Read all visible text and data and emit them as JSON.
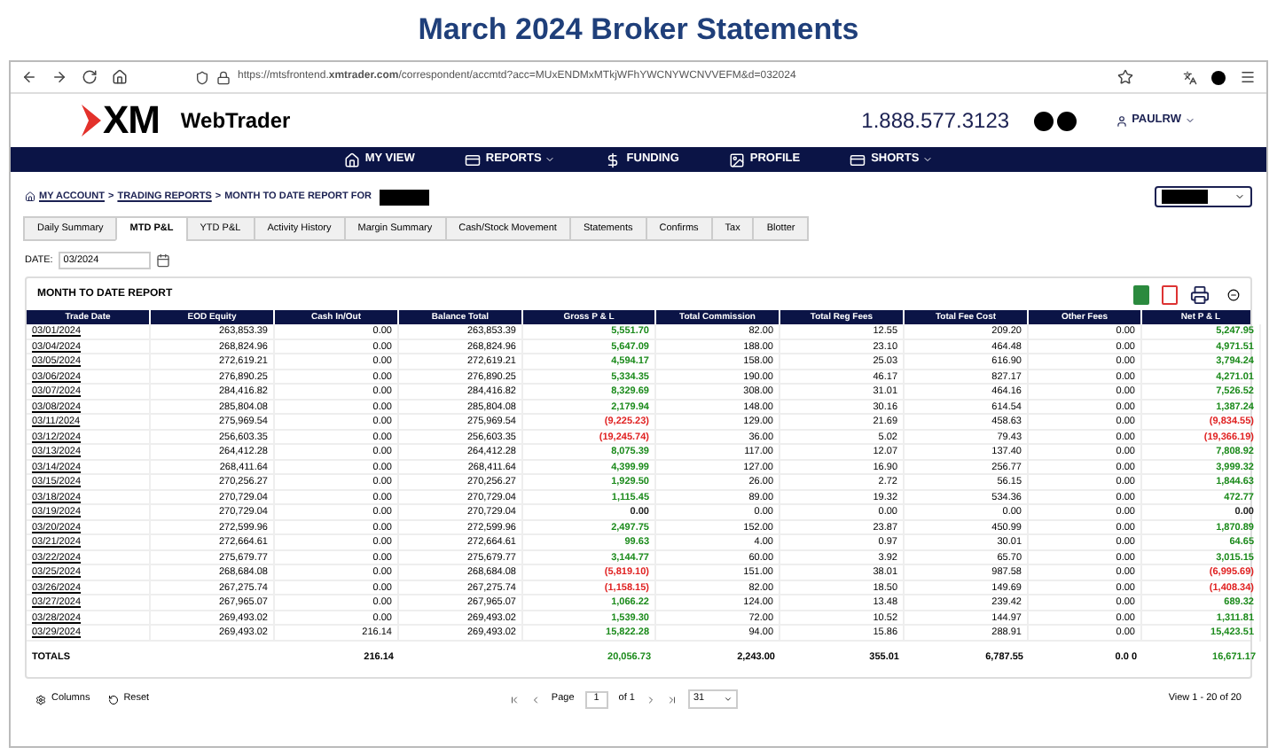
{
  "page_title": "March 2024 Broker Statements",
  "browser": {
    "url": "https://mtsfrontend.**xmtrader.com**/correspondent/accmtd?acc=MUxENDMxMTkjWFhYWCNYWCNVVEFM&d=032024"
  },
  "header": {
    "logo": "XM",
    "app_name": "WebTrader",
    "phone": "1.888.577.3123",
    "user": "PAULRW"
  },
  "nav": [
    {
      "label": "MY VIEW",
      "kind": "home",
      "dropdown": false
    },
    {
      "label": "REPORTS",
      "kind": "card",
      "dropdown": true
    },
    {
      "label": "FUNDING",
      "kind": "dollar",
      "dropdown": false
    },
    {
      "label": "PROFILE",
      "kind": "image",
      "dropdown": false
    },
    {
      "label": "SHORTS",
      "kind": "card",
      "dropdown": true
    }
  ],
  "breadcrumb": [
    {
      "label": "MY ACCOUNT",
      "link": true
    },
    {
      "label": ">",
      "link": false
    },
    {
      "label": "TRADING REPORTS",
      "link": true
    },
    {
      "label": ">",
      "link": false
    },
    {
      "label": "MONTH TO DATE REPORT FOR",
      "link": false
    }
  ],
  "tabs": [
    {
      "label": "Daily Summary",
      "selected": false
    },
    {
      "label": "MTD P&L",
      "selected": true
    },
    {
      "label": "YTD P&L",
      "selected": false
    },
    {
      "label": "Activity History",
      "selected": false
    },
    {
      "label": "Margin Summary",
      "selected": false
    },
    {
      "label": "Cash/Stock Movement",
      "selected": false
    },
    {
      "label": "Statements",
      "selected": false
    },
    {
      "label": "Confirms",
      "selected": false
    },
    {
      "label": "Tax",
      "selected": false
    },
    {
      "label": "Blotter",
      "selected": false
    }
  ],
  "date": {
    "label": "DATE:",
    "value": "03/2024"
  },
  "report": {
    "title": "MONTH TO DATE REPORT",
    "columns": [
      "Trade Date",
      "EOD Equity",
      "Cash In/Out",
      "Balance Total",
      "Gross P & L",
      "Total Commission",
      "Total Reg Fees",
      "Total Fee Cost",
      "Other Fees",
      "Net P & L"
    ],
    "rows": [
      {
        "cells": [
          "03/01/2024",
          "263,853.39",
          "0.00",
          "263,853.39",
          {
            "value": "5,551.70",
            "color": "#1a8a1a"
          },
          "82.00",
          "12.55",
          "209.20",
          "0.00",
          {
            "value": "5,247.95",
            "color": "#1a8a1a"
          }
        ]
      },
      {
        "cells": [
          "03/04/2024",
          "268,824.96",
          "0.00",
          "268,824.96",
          {
            "value": "5,647.09",
            "color": "#1a8a1a"
          },
          "188.00",
          "23.10",
          "464.48",
          "0.00",
          {
            "value": "4,971.51",
            "color": "#1a8a1a"
          }
        ]
      },
      {
        "cells": [
          "03/05/2024",
          "272,619.21",
          "0.00",
          "272,619.21",
          {
            "value": "4,594.17",
            "color": "#1a8a1a"
          },
          "158.00",
          "25.03",
          "616.90",
          "0.00",
          {
            "value": "3,794.24",
            "color": "#1a8a1a"
          }
        ]
      },
      {
        "cells": [
          "03/06/2024",
          "276,890.25",
          "0.00",
          "276,890.25",
          {
            "value": "5,334.35",
            "color": "#1a8a1a"
          },
          "190.00",
          "46.17",
          "827.17",
          "0.00",
          {
            "value": "4,271.01",
            "color": "#1a8a1a"
          }
        ]
      },
      {
        "cells": [
          "03/07/2024",
          "284,416.82",
          "0.00",
          "284,416.82",
          {
            "value": "8,329.69",
            "color": "#1a8a1a"
          },
          "308.00",
          "31.01",
          "464.16",
          "0.00",
          {
            "value": "7,526.52",
            "color": "#1a8a1a"
          }
        ]
      },
      {
        "cells": [
          "03/08/2024",
          "285,804.08",
          "0.00",
          "285,804.08",
          {
            "value": "2,179.94",
            "color": "#1a8a1a"
          },
          "148.00",
          "30.16",
          "614.54",
          "0.00",
          {
            "value": "1,387.24",
            "color": "#1a8a1a"
          }
        ]
      },
      {
        "cells": [
          "03/11/2024",
          "275,969.54",
          "0.00",
          "275,969.54",
          {
            "value": "(9,225.23)",
            "color": "#e02020"
          },
          "129.00",
          "21.69",
          "458.63",
          "0.00",
          {
            "value": "(9,834.55)",
            "color": "#e02020"
          }
        ]
      },
      {
        "cells": [
          "03/12/2024",
          "256,603.35",
          "0.00",
          "256,603.35",
          {
            "value": "(19,245.74)",
            "color": "#e02020"
          },
          "36.00",
          "5.02",
          "79.43",
          "0.00",
          {
            "value": "(19,366.19)",
            "color": "#e02020"
          }
        ]
      },
      {
        "cells": [
          "03/13/2024",
          "264,412.28",
          "0.00",
          "264,412.28",
          {
            "value": "8,075.39",
            "color": "#1a8a1a"
          },
          "117.00",
          "12.07",
          "137.40",
          "0.00",
          {
            "value": "7,808.92",
            "color": "#1a8a1a"
          }
        ]
      },
      {
        "cells": [
          "03/14/2024",
          "268,411.64",
          "0.00",
          "268,411.64",
          {
            "value": "4,399.99",
            "color": "#1a8a1a"
          },
          "127.00",
          "16.90",
          "256.77",
          "0.00",
          {
            "value": "3,999.32",
            "color": "#1a8a1a"
          }
        ]
      },
      {
        "cells": [
          "03/15/2024",
          "270,256.27",
          "0.00",
          "270,256.27",
          {
            "value": "1,929.50",
            "color": "#1a8a1a"
          },
          "26.00",
          "2.72",
          "56.15",
          "0.00",
          {
            "value": "1,844.63",
            "color": "#1a8a1a"
          }
        ]
      },
      {
        "cells": [
          "03/18/2024",
          "270,729.04",
          "0.00",
          "270,729.04",
          {
            "value": "1,115.45",
            "color": "#1a8a1a"
          },
          "89.00",
          "19.32",
          "534.36",
          "0.00",
          {
            "value": "472.77",
            "color": "#1a8a1a"
          }
        ]
      },
      {
        "cells": [
          "03/19/2024",
          "270,729.04",
          "0.00",
          "270,729.04",
          {
            "value": "0.00",
            "color": "#222222"
          },
          "0.00",
          "0.00",
          "0.00",
          "0.00",
          {
            "value": "0.00",
            "color": "#222222"
          }
        ]
      },
      {
        "cells": [
          "03/20/2024",
          "272,599.96",
          "0.00",
          "272,599.96",
          {
            "value": "2,497.75",
            "color": "#1a8a1a"
          },
          "152.00",
          "23.87",
          "450.99",
          "0.00",
          {
            "value": "1,870.89",
            "color": "#1a8a1a"
          }
        ]
      },
      {
        "cells": [
          "03/21/2024",
          "272,664.61",
          "0.00",
          "272,664.61",
          {
            "value": "99.63",
            "color": "#1a8a1a"
          },
          "4.00",
          "0.97",
          "30.01",
          "0.00",
          {
            "value": "64.65",
            "color": "#1a8a1a"
          }
        ]
      },
      {
        "cells": [
          "03/22/2024",
          "275,679.77",
          "0.00",
          "275,679.77",
          {
            "value": "3,144.77",
            "color": "#1a8a1a"
          },
          "60.00",
          "3.92",
          "65.70",
          "0.00",
          {
            "value": "3,015.15",
            "color": "#1a8a1a"
          }
        ]
      },
      {
        "cells": [
          "03/25/2024",
          "268,684.08",
          "0.00",
          "268,684.08",
          {
            "value": "(5,819.10)",
            "color": "#e02020"
          },
          "151.00",
          "38.01",
          "987.58",
          "0.00",
          {
            "value": "(6,995.69)",
            "color": "#e02020"
          }
        ]
      },
      {
        "cells": [
          "03/26/2024",
          "267,275.74",
          "0.00",
          "267,275.74",
          {
            "value": "(1,158.15)",
            "color": "#e02020"
          },
          "82.00",
          "18.50",
          "149.69",
          "0.00",
          {
            "value": "(1,408.34)",
            "color": "#e02020"
          }
        ]
      },
      {
        "cells": [
          "03/27/2024",
          "267,965.07",
          "0.00",
          "267,965.07",
          {
            "value": "1,066.22",
            "color": "#1a8a1a"
          },
          "124.00",
          "13.48",
          "239.42",
          "0.00",
          {
            "value": "689.32",
            "color": "#1a8a1a"
          }
        ]
      },
      {
        "cells": [
          "03/28/2024",
          "269,493.02",
          "0.00",
          "269,493.02",
          {
            "value": "1,539.30",
            "color": "#1a8a1a"
          },
          "72.00",
          "10.52",
          "144.97",
          "0.00",
          {
            "value": "1,311.81",
            "color": "#1a8a1a"
          }
        ]
      },
      {
        "cells": [
          "03/29/2024",
          "269,493.02",
          "216.14",
          "269,493.02",
          {
            "value": "15,822.28",
            "color": "#1a8a1a"
          },
          "94.00",
          "15.86",
          "288.91",
          "0.00",
          {
            "value": "15,423.51",
            "color": "#1a8a1a"
          }
        ]
      }
    ],
    "totals": {
      "label": "TOTALS",
      "cash": "216.14",
      "gross": {
        "value": "20,056.73",
        "color": "#1a8a1a"
      },
      "commission": "2,243.00",
      "reg_fees": "355.01",
      "fee_cost": "6,787.55",
      "other_fees": "0.0 0",
      "net": {
        "value": "16,671.17",
        "color": "#1a8a1a"
      }
    }
  },
  "pager": {
    "columns_label": "Columns",
    "reset_label": "Reset",
    "page_label": "Page",
    "page": "1",
    "of_label": "of 1",
    "per_page": "31",
    "summary": "View 1 - 20 of 20"
  }
}
